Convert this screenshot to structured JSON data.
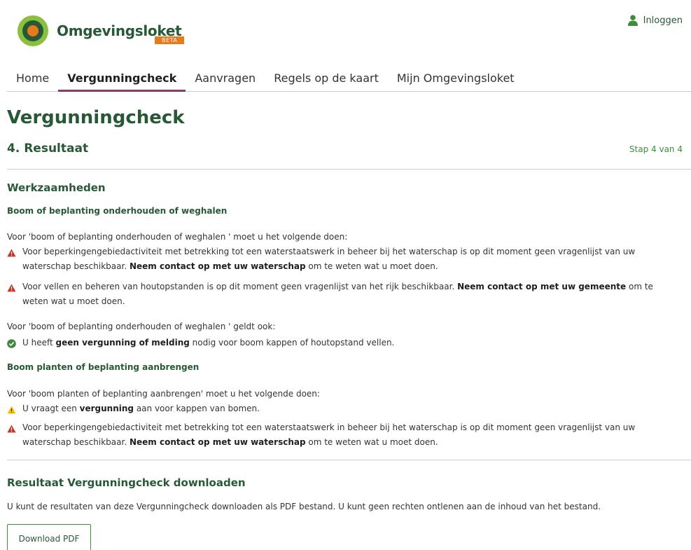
{
  "header": {
    "logo_text": "Omgevingsloket",
    "logo_badge": "BETA",
    "login_label": "Inloggen"
  },
  "nav": {
    "items": [
      {
        "label": "Home"
      },
      {
        "label": "Vergunningcheck",
        "active": true
      },
      {
        "label": "Aanvragen"
      },
      {
        "label": "Regels op de kaart"
      },
      {
        "label": "Mijn Omgevingsloket"
      }
    ]
  },
  "page": {
    "title": "Vergunningcheck",
    "step_title": "4. Resultaat",
    "step_count": "Stap 4 van 4"
  },
  "results": {
    "heading": "Werkzaamheden",
    "group1": {
      "title": "Boom of beplanting onderhouden of weghalen",
      "intro": "Voor 'boom of beplanting onderhouden of weghalen ' moet u het volgende doen:",
      "notice1": {
        "type": "warning-red",
        "before": "Voor beperkingengebiedactiviteit met betrekking tot een waterstaatswerk in beheer bij het waterschap is op dit moment geen vragenlijst van uw waterschap beschikbaar. ",
        "bold": "Neem contact op met uw waterschap",
        "after": " om te weten wat u moet doen."
      },
      "notice2": {
        "type": "warning-red",
        "before": "Voor vellen en beheren van houtopstanden is op dit moment geen vragenlijst van het rijk beschikbaar. ",
        "bold": "Neem contact op met uw gemeente",
        "after": " om te weten wat u moet doen."
      },
      "also_intro": "Voor 'boom of beplanting onderhouden of weghalen ' geldt ook:",
      "notice3": {
        "type": "check-green",
        "before": "U heeft ",
        "bold": "geen vergunning of melding",
        "after": " nodig voor boom kappen of houtopstand vellen."
      }
    },
    "group2": {
      "title": "Boom planten of beplanting aanbrengen",
      "intro": "Voor 'boom planten of beplanting aanbrengen' moet u het volgende doen:",
      "notice1": {
        "type": "warning-yellow",
        "before": "U vraagt een ",
        "bold": "vergunning",
        "after": " aan voor kappen van bomen."
      },
      "notice2": {
        "type": "warning-red",
        "before": "Voor beperkingengebiedactiviteit met betrekking tot een waterstaatswerk in beheer bij het waterschap is op dit moment geen vragenlijst van uw waterschap beschikbaar. ",
        "bold": "Neem contact op met uw waterschap",
        "after": " om te weten wat u moet doen."
      }
    }
  },
  "download": {
    "heading": "Resultaat Vergunningcheck downloaden",
    "text": "U kunt de resultaten van deze Vergunningcheck downloaden als PDF bestand. U kunt geen rechten ontlenen aan de inhoud van het bestand.",
    "button_label": "Download PDF"
  },
  "colors": {
    "brand_green": "#275937",
    "accent_purple": "#8a3b6b",
    "warning_red": "#c0392b",
    "warning_yellow": "#f2c200",
    "success_green": "#3e8a3e"
  }
}
